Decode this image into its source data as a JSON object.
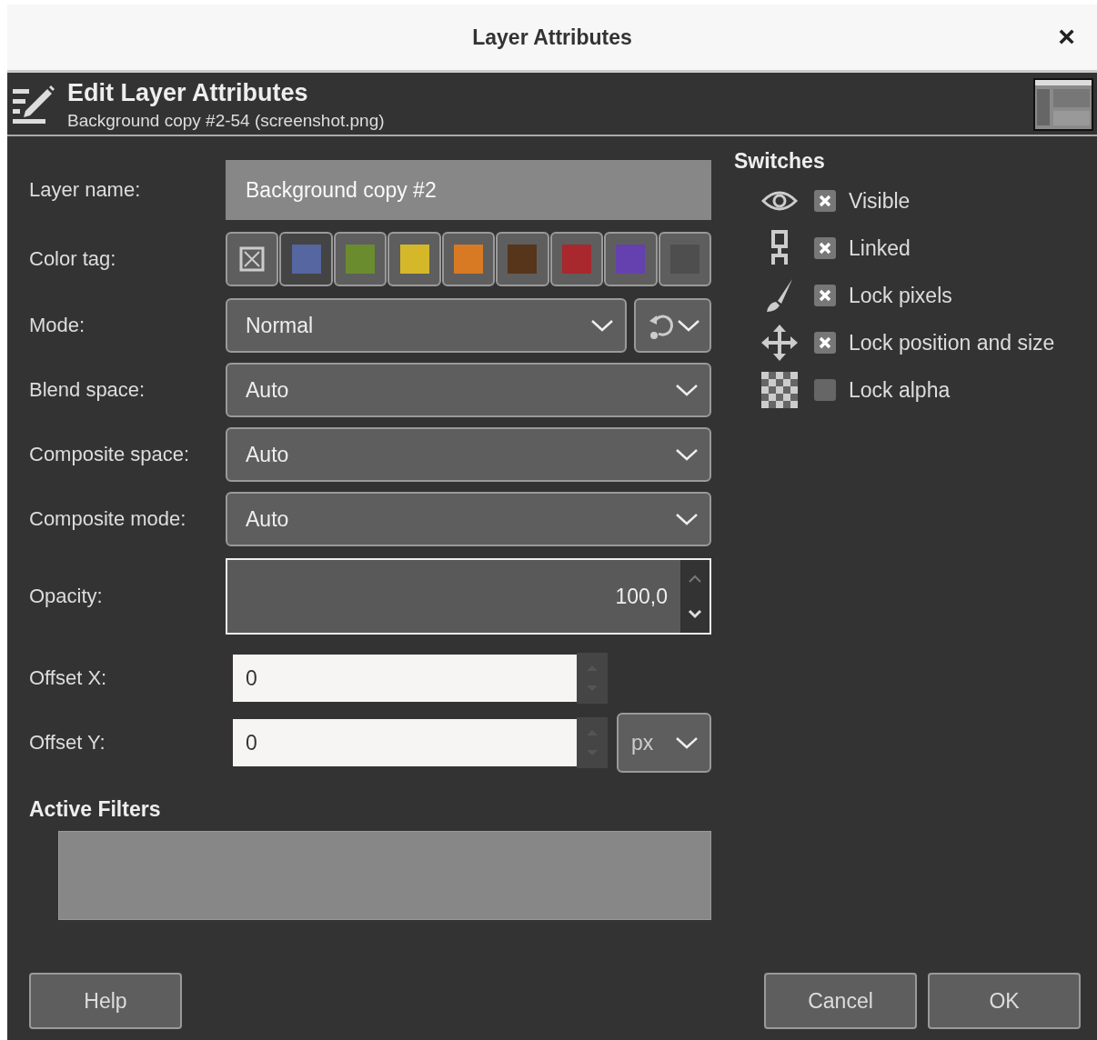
{
  "window": {
    "title": "Layer Attributes",
    "close": "×"
  },
  "header": {
    "title": "Edit Layer Attributes",
    "subtitle": "Background copy #2-54 (screenshot.png)"
  },
  "form": {
    "layer_name": {
      "label": "Layer name:",
      "value": "Background copy #2"
    },
    "color_tag": {
      "label": "Color tag:",
      "options": [
        {
          "kind": "none",
          "selected": false
        },
        {
          "kind": "swatch",
          "color": "#5566a0",
          "selected": true
        },
        {
          "kind": "swatch",
          "color": "#6b8c2e",
          "selected": false
        },
        {
          "kind": "swatch",
          "color": "#d4b82a",
          "selected": false
        },
        {
          "kind": "swatch",
          "color": "#d87a24",
          "selected": false
        },
        {
          "kind": "swatch",
          "color": "#56351a",
          "selected": false
        },
        {
          "kind": "swatch",
          "color": "#a8282e",
          "selected": false
        },
        {
          "kind": "swatch",
          "color": "#6441ae",
          "selected": false
        },
        {
          "kind": "swatch",
          "color": "#4e4e4e",
          "selected": false
        }
      ]
    },
    "mode": {
      "label": "Mode:",
      "value": "Normal"
    },
    "blend_space": {
      "label": "Blend space:",
      "value": "Auto"
    },
    "composite_space": {
      "label": "Composite space:",
      "value": "Auto"
    },
    "composite_mode": {
      "label": "Composite mode:",
      "value": "Auto"
    },
    "opacity": {
      "label": "Opacity:",
      "value": "100,0"
    },
    "offset_x": {
      "label": "Offset X:",
      "value": "0"
    },
    "offset_y": {
      "label": "Offset Y:",
      "value": "0",
      "unit": "px"
    }
  },
  "switches": {
    "title": "Switches",
    "items": [
      {
        "label": "Visible",
        "checked": true
      },
      {
        "label": "Linked",
        "checked": true
      },
      {
        "label": "Lock pixels",
        "checked": true
      },
      {
        "label": "Lock position and size",
        "checked": true
      },
      {
        "label": "Lock alpha",
        "checked": false
      }
    ]
  },
  "active_filters": {
    "title": "Active Filters"
  },
  "buttons": {
    "help": "Help",
    "cancel": "Cancel",
    "ok": "OK"
  }
}
